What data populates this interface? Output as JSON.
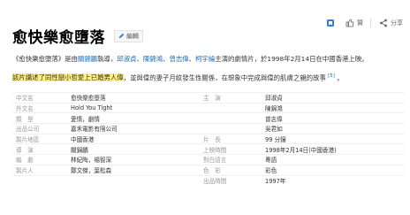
{
  "toolbar": {
    "items": [
      {
        "icon": "bookmark-icon",
        "label": ""
      },
      {
        "icon": "thumbs-up-icon",
        "label": "贊"
      },
      {
        "icon": "share-icon",
        "label": "分享"
      }
    ]
  },
  "header": {
    "title": "愈快樂愈墮落",
    "edit_label": "編輯"
  },
  "summary": {
    "line1_prefix": "《愈快樂愈墮落》是由",
    "director_link": "關錦鵬",
    "line1_mid": "執導，",
    "cast_links": [
      "邱淑貞",
      "陳錦鴻",
      "曾志偉",
      "柯宇綸"
    ],
    "line1_suffix": "主演的劇情片，於1998年2月14日在中國香港上映。",
    "line2_highlight": "該片講述了同性戀小哲愛上已婚男人",
    "line2_highlight_2": "偉",
    "line2_rest": "，並與偉的妻子月紋發生性關係，在想象中完成與偉的肌膚之親的故事",
    "ref": "[5]",
    "line2_end": "。"
  },
  "info": {
    "rows": [
      {
        "k1": "中文名",
        "v1": "愈快樂愈墮落",
        "k2": "主　演",
        "v2": "邱淑貞"
      },
      {
        "k1": "外文名",
        "v1": "Hold You Tight",
        "k2": "",
        "v2": "陳錦鴻"
      },
      {
        "k1": "類　型",
        "v1": "愛情，劇情",
        "k2": "",
        "v2": "曾志偉"
      },
      {
        "k1": "出品公司",
        "v1": "嘉禾電影有限公司",
        "k2": "",
        "v2": "吳君如"
      },
      {
        "k1": "製片地區",
        "v1": "中國香港",
        "k2": "片　長",
        "v2": "99 分鐘"
      },
      {
        "k1": "導　演",
        "v1": "關錦鵬",
        "k2": "上映時間",
        "v2": "1998年2月14日(中國香港)"
      },
      {
        "k1": "編　劇",
        "v1": "林紀陶，楊智深",
        "k2": "對白語言",
        "v2": "粵語"
      },
      {
        "k1": "製片人",
        "v1": "鄭文傑，葉松森",
        "k2": "色　彩",
        "v2": "彩色"
      },
      {
        "k1": "",
        "v1": "",
        "k2": "出品時間",
        "v2": "1997年"
      }
    ]
  }
}
